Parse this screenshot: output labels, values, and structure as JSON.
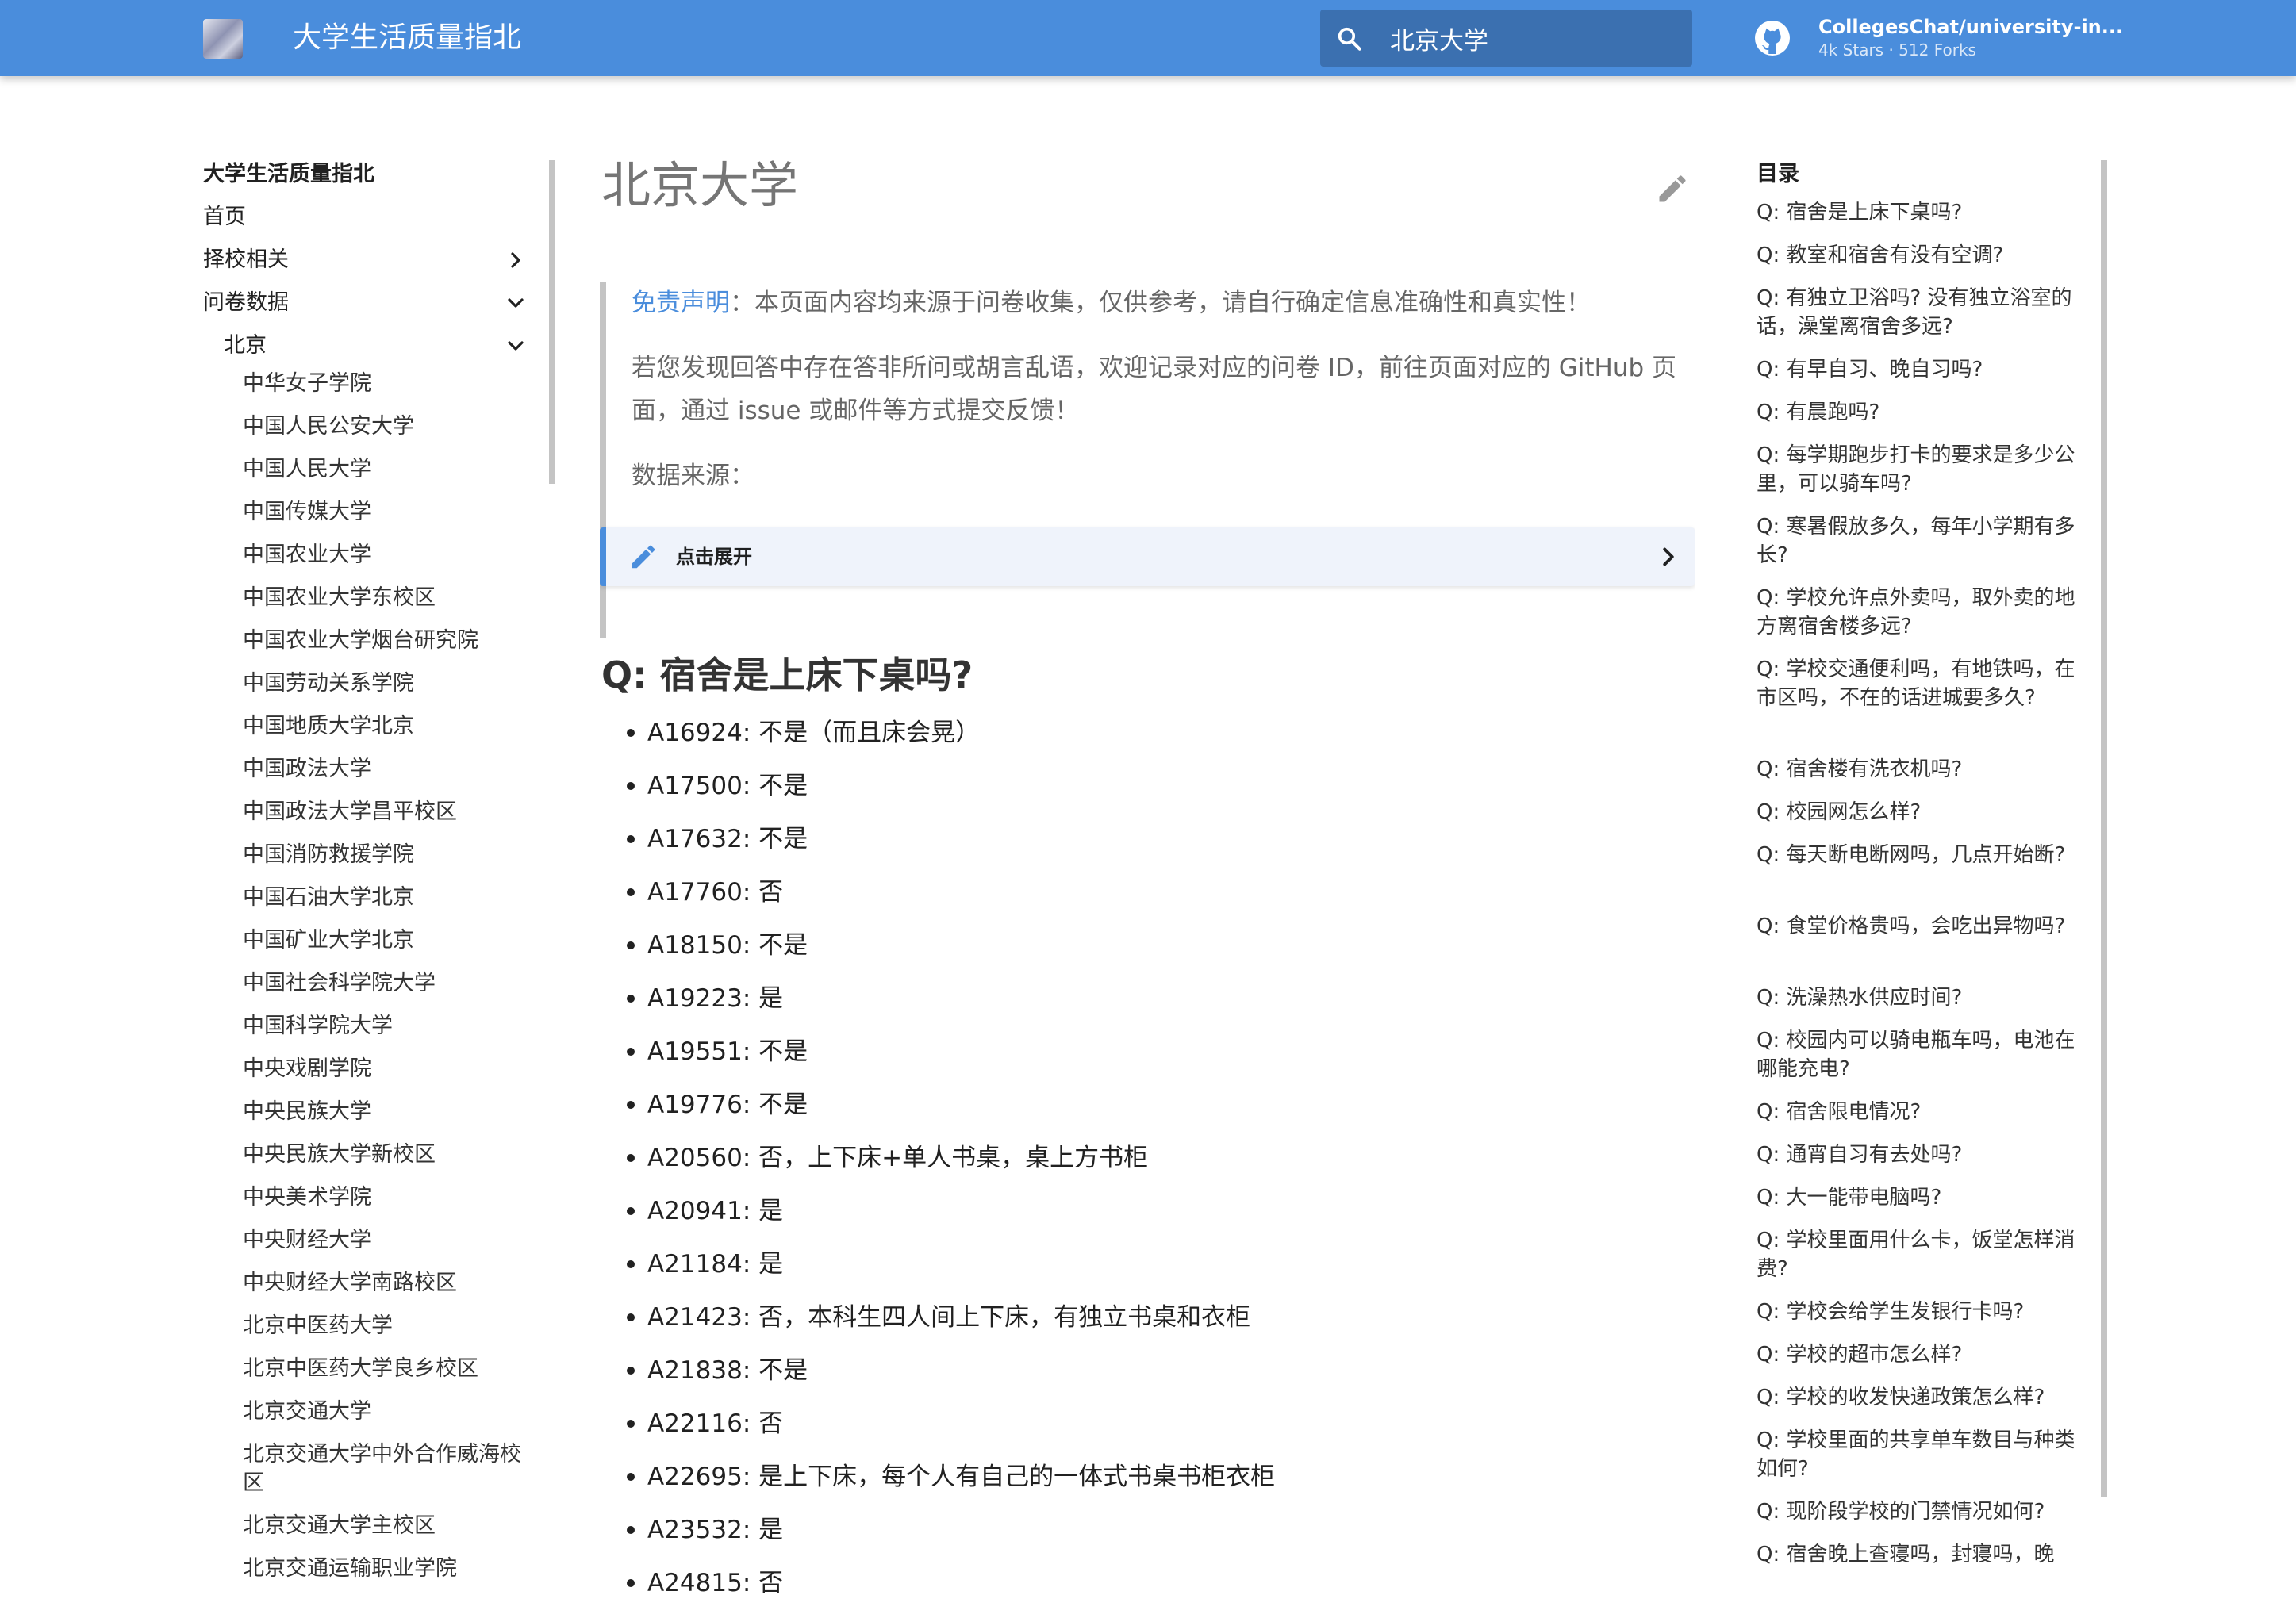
{
  "header": {
    "site_title": "大学生活质量指北",
    "search_value": "北京大学",
    "repo_name": "CollegesChat/university-in...",
    "repo_facts": "4k Stars · 512 Forks"
  },
  "nav": {
    "title": "大学生活质量指北",
    "items": [
      "首页",
      "择校相关",
      "问卷数据",
      "北京"
    ],
    "universities": [
      "中华女子学院",
      "中国人民公安大学",
      "中国人民大学",
      "中国传媒大学",
      "中国农业大学",
      "中国农业大学东校区",
      "中国农业大学烟台研究院",
      "中国劳动关系学院",
      "中国地质大学北京",
      "中国政法大学",
      "中国政法大学昌平校区",
      "中国消防救援学院",
      "中国石油大学北京",
      "中国矿业大学北京",
      "中国社会科学院大学",
      "中国科学院大学",
      "中央戏剧学院",
      "中央民族大学",
      "中央民族大学新校区",
      "中央美术学院",
      "中央财经大学",
      "中央财经大学南路校区",
      "北京中医药大学",
      "北京中医药大学良乡校区",
      "北京交通大学",
      "北京交通大学中外合作威海校区",
      "北京交通大学主校区",
      "北京交通运输职业学院"
    ]
  },
  "content": {
    "title": "北京大学",
    "disclaimer_link": "免责声明",
    "disclaimer_text": "：本页面内容均来源于问卷收集，仅供参考，请自行确定信息准确性和真实性！",
    "feedback_text": "若您发现回答中存在答非所问或胡言乱语，欢迎记录对应的问卷 ID，前往页面对应的 GitHub 页面，通过 issue 或邮件等方式提交反馈！",
    "source_text": "数据来源：",
    "expand_label": "点击展开",
    "question": "Q: 宿舍是上床下桌吗?",
    "answers": [
      "A16924: 不是（而且床会晃）",
      "A17500: 不是",
      "A17632: 不是",
      "A17760: 否",
      "A18150: 不是",
      "A19223: 是",
      "A19551: 不是",
      "A19776: 不是",
      "A20560: 否，上下床+单人书桌，桌上方书柜",
      "A20941: 是",
      "A21184: 是",
      "A21423: 否，本科生四人间上下床，有独立书桌和衣柜",
      "A21838: 不是",
      "A22116: 否",
      "A22695: 是上下床，每个人有自己的一体式书桌书柜衣柜",
      "A23532: 是",
      "A24815: 否"
    ]
  },
  "toc": {
    "title": "目录",
    "items": [
      "Q: 宿舍是上床下桌吗?",
      "Q: 教室和宿舍有没有空调?",
      "Q: 有独立卫浴吗? 没有独立浴室的话，澡堂离宿舍多远?",
      "Q: 有早自习、晚自习吗?",
      "Q: 有晨跑吗?",
      "Q: 每学期跑步打卡的要求是多少公里，可以骑车吗?",
      "Q: 寒暑假放多久，每年小学期有多长?",
      "Q: 学校允许点外卖吗，取外卖的地方离宿舍楼多远?",
      "Q: 学校交通便利吗，有地铁吗，在市区吗，不在的话进城要多久?",
      "Q: 宿舍楼有洗衣机吗?",
      "Q: 校园网怎么样?",
      "Q: 每天断电断网吗，几点开始断?",
      "Q: 食堂价格贵吗，会吃出异物吗?",
      "Q: 洗澡热水供应时间?",
      "Q: 校园内可以骑电瓶车吗，电池在哪能充电?",
      "Q: 宿舍限电情况?",
      "Q: 通宵自习有去处吗?",
      "Q: 大一能带电脑吗?",
      "Q: 学校里面用什么卡，饭堂怎样消费?",
      "Q: 学校会给学生发银行卡吗?",
      "Q: 学校的超市怎么样?",
      "Q: 学校的收发快递政策怎么样?",
      "Q: 学校里面的共享单车数目与种类如何?",
      "Q: 现阶段学校的门禁情况如何?",
      "Q: 宿舍晚上查寝吗，封寝吗，晚"
    ]
  }
}
